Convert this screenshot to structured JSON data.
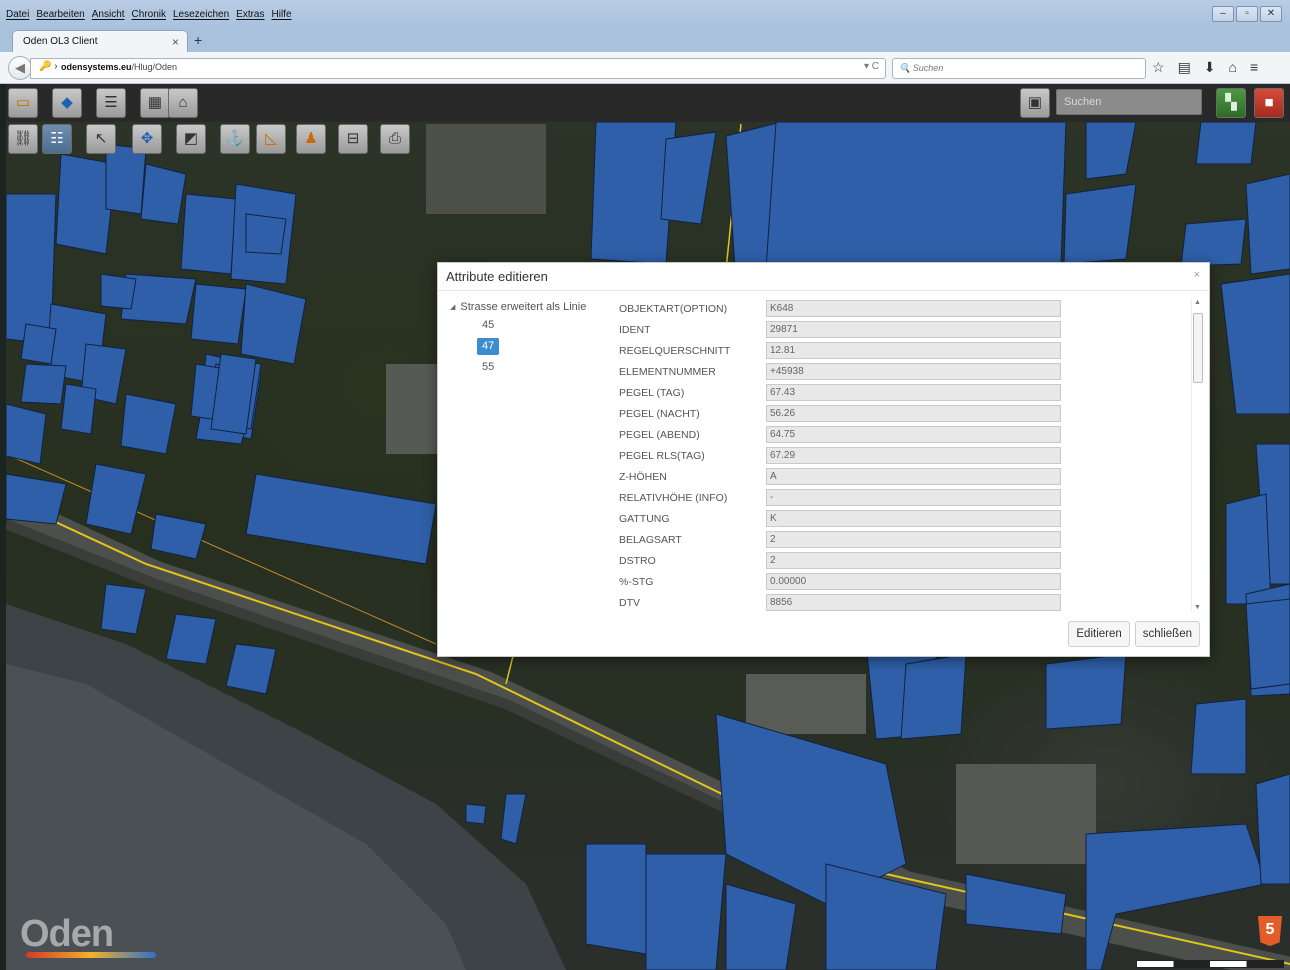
{
  "browser": {
    "menu": [
      "Datei",
      "Bearbeiten",
      "Ansicht",
      "Chronik",
      "Lesezeichen",
      "Extras",
      "Hilfe"
    ],
    "tab_title": "Oden OL3 Client",
    "url_host": "odensystems.eu",
    "url_path": "/Hlug/Oden",
    "search_placeholder": "Suchen"
  },
  "app": {
    "search_placeholder": "Suchen",
    "logo_text": "Oden",
    "html5_label": "5"
  },
  "dialog": {
    "title": "Attribute editieren",
    "tree": {
      "root": "Strasse erweitert als Linie",
      "children": [
        "45",
        "47",
        "55"
      ],
      "selected": "47"
    },
    "fields": [
      {
        "label": "OBJEKTART(OPTION)",
        "value": "K648"
      },
      {
        "label": "IDENT",
        "value": "29871"
      },
      {
        "label": "REGELQUERSCHNITT",
        "value": "12.81"
      },
      {
        "label": "ELEMENTNUMMER",
        "value": "+45938"
      },
      {
        "label": "PEGEL (TAG)",
        "value": "67.43"
      },
      {
        "label": "PEGEL (NACHT)",
        "value": "56.26"
      },
      {
        "label": "PEGEL (ABEND)",
        "value": "64.75"
      },
      {
        "label": "PEGEL RLS(TAG)",
        "value": "67.29"
      },
      {
        "label": "Z-HÖHEN",
        "value": "A"
      },
      {
        "label": "RELATIVHÖHE (INFO)",
        "value": "-"
      },
      {
        "label": "GATTUNG",
        "value": "K"
      },
      {
        "label": "BELAGSART",
        "value": "2"
      },
      {
        "label": "DSTRO",
        "value": "2"
      },
      {
        "label": "%-STG",
        "value": "0.00000"
      },
      {
        "label": "DTV",
        "value": "8856"
      }
    ],
    "buttons": {
      "edit": "Editieren",
      "close": "schließen"
    }
  },
  "colors": {
    "building": "#2e5fa8",
    "road_line": "#e0c51a",
    "selected": "#3c8dcb"
  }
}
